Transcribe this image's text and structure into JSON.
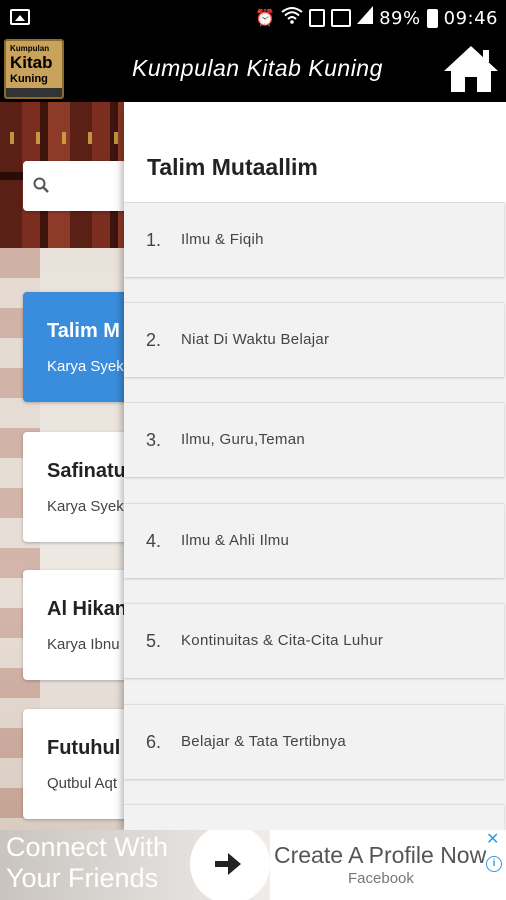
{
  "status_bar": {
    "battery_percent": "89%",
    "time": "09:46",
    "icons": [
      "image-icon",
      "alarm-icon",
      "wifi-icon",
      "sim-icon",
      "signal-icon",
      "battery-icon"
    ]
  },
  "app_bar": {
    "logo_lines": [
      "Kumpulan",
      "Kitab",
      "Kuning"
    ],
    "title": "Kumpulan Kitab Kuning",
    "home_icon": "home-icon"
  },
  "search": {
    "icon": "search-icon",
    "placeholder": ""
  },
  "book_list": [
    {
      "title": "Talim M",
      "subtitle": "Karya Syek",
      "active": true
    },
    {
      "title": "Safinatu",
      "subtitle": "Karya Syek",
      "active": false
    },
    {
      "title": "Al Hikan",
      "subtitle": "Karya Ibnu",
      "active": false
    },
    {
      "title": "Futuhul",
      "subtitle": "Qutbul Aqt",
      "active": false
    }
  ],
  "drawer": {
    "title": "Talim Mutaallim",
    "chapters": [
      {
        "num": "1.",
        "label": "Ilmu & Fiqih"
      },
      {
        "num": "2.",
        "label": "Niat Di Waktu Belajar"
      },
      {
        "num": "3.",
        "label": "Ilmu, Guru,Teman"
      },
      {
        "num": "4.",
        "label": "Ilmu & Ahli Ilmu"
      },
      {
        "num": "5.",
        "label": "Kontinuitas & Cita-Cita Luhur"
      },
      {
        "num": "6.",
        "label": "Belajar & Tata Tertibnya"
      }
    ]
  },
  "ad": {
    "left_line1": "Connect With",
    "left_line2": "Your Friends",
    "headline": "Create A Profile Now",
    "advertiser": "Facebook",
    "close_icon": "close-icon",
    "info_icon": "info-icon"
  }
}
